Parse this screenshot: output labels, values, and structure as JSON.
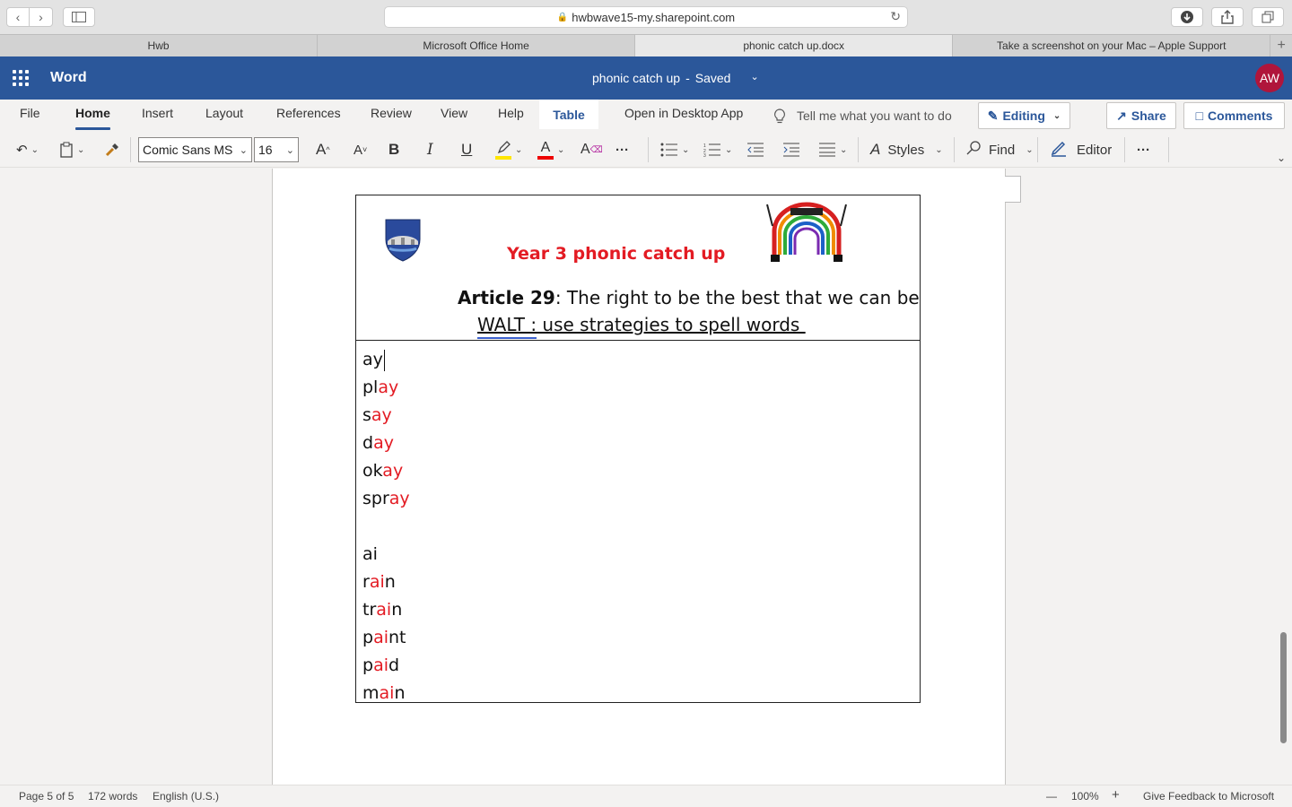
{
  "browser": {
    "url": "hwbwave15-my.sharepoint.com",
    "tabs": [
      {
        "label": "Hwb"
      },
      {
        "label": "Microsoft Office Home"
      },
      {
        "label": "phonic catch up.docx"
      },
      {
        "label": "Take a screenshot on your Mac – Apple Support"
      }
    ],
    "new_tab": "+"
  },
  "app": {
    "name": "Word",
    "doc_name": "phonic catch up",
    "separator": "-",
    "save_status": "Saved",
    "user_initials": "AW",
    "brand_color": "#2b579a"
  },
  "ribbon": {
    "tabs": [
      "File",
      "Home",
      "Insert",
      "Layout",
      "References",
      "Review",
      "View",
      "Help",
      "Table"
    ],
    "open_desktop": "Open in Desktop App",
    "tell_me": "Tell me what you want to do",
    "editing": "Editing",
    "share": "Share",
    "comments": "Comments",
    "font_name": "Comic Sans MS",
    "font_size": "16",
    "bold": "B",
    "italic": "I",
    "underline": "U",
    "more": "···",
    "styles": "Styles",
    "find": "Find",
    "editor": "Editor"
  },
  "document": {
    "heading": "Year 3 phonic catch up",
    "article_bold": "Article 29",
    "article_rest": ": The right to be the best that we can be",
    "walt": "WALT : use strategies to spell words ",
    "words": [
      {
        "plain": "ay",
        "red": ""
      },
      {
        "plain": "pl",
        "red": "ay"
      },
      {
        "plain": "s",
        "red": "ay"
      },
      {
        "plain": "d",
        "red": "ay"
      },
      {
        "plain": "ok",
        "red": "ay"
      },
      {
        "plain": "spr",
        "red": "ay"
      },
      {
        "plain": "",
        "red": ""
      },
      {
        "plain": "ai",
        "red": ""
      },
      {
        "plain": "r",
        "red": "ai",
        "after": "n"
      },
      {
        "plain": "tr",
        "red": "ai",
        "after": "n"
      },
      {
        "plain": "p",
        "red": "ai",
        "after": "nt"
      },
      {
        "plain": "p",
        "red": "ai",
        "after": "d"
      },
      {
        "plain": "m",
        "red": "ai",
        "after": "n"
      }
    ],
    "accent_red": "#e31b23"
  },
  "status": {
    "page": "Page 5 of 5",
    "words": "172 words",
    "language": "English (U.S.)",
    "zoom_out": "—",
    "zoom": "100%",
    "zoom_in": "+",
    "feedback": "Give Feedback to Microsoft"
  }
}
